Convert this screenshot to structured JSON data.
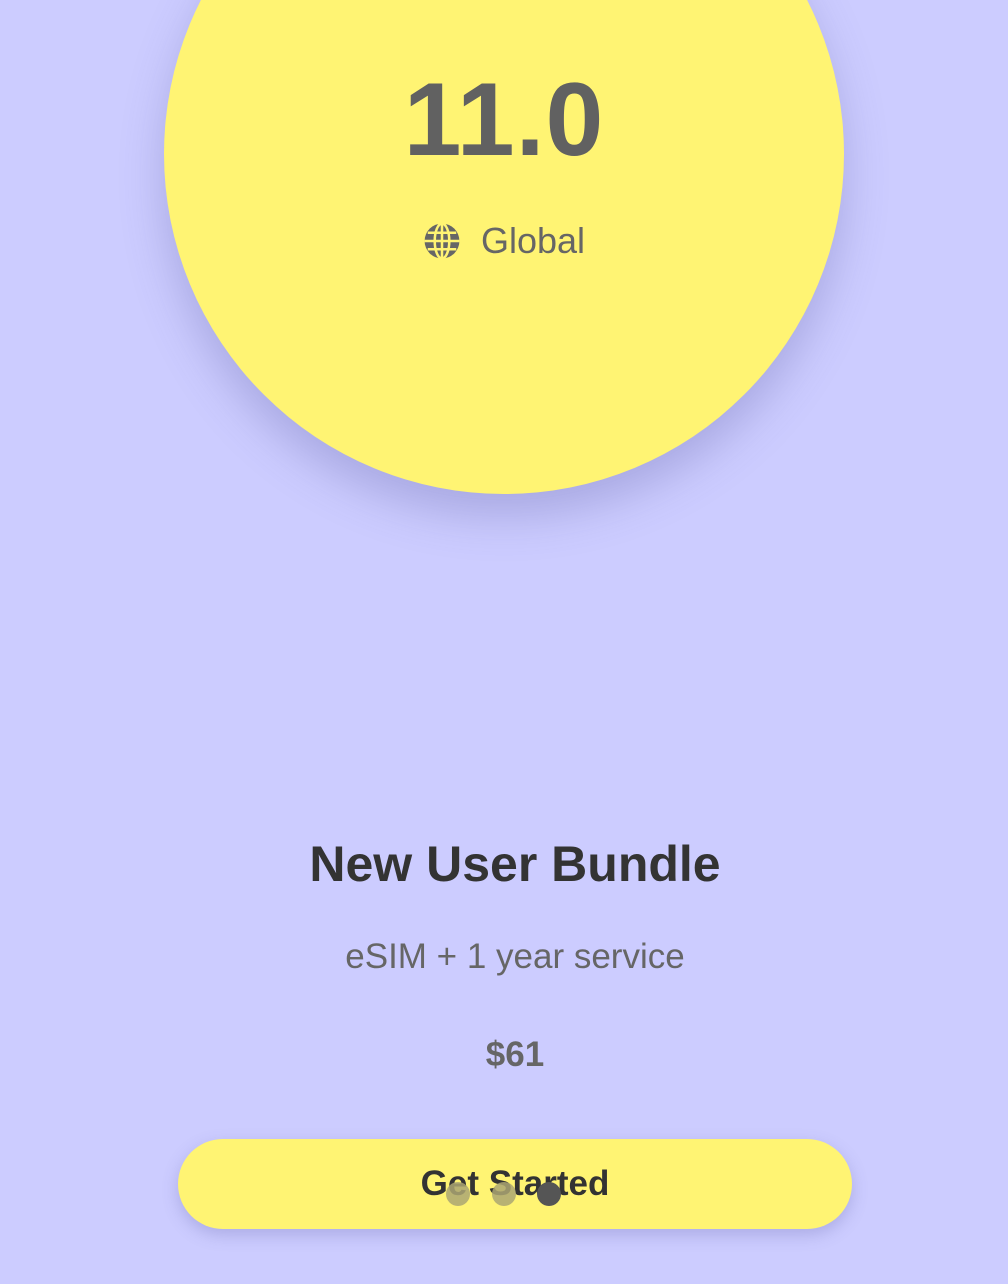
{
  "theme": {
    "background": "#CCCCFF",
    "accent": "#FFF473",
    "text_dark": "#333333",
    "text_muted": "#666666",
    "dot_inactive": "#ABA673",
    "dot_active": "#555555"
  },
  "hero": {
    "value": "11.0",
    "region_icon": "globe-icon",
    "region_label": "Global"
  },
  "bundle": {
    "title": "New User Bundle",
    "subtitle": "eSIM + 1 year service",
    "price": "$61"
  },
  "cta": {
    "label": "Get Started"
  },
  "pager": {
    "pages": 3,
    "active_index": 3
  }
}
